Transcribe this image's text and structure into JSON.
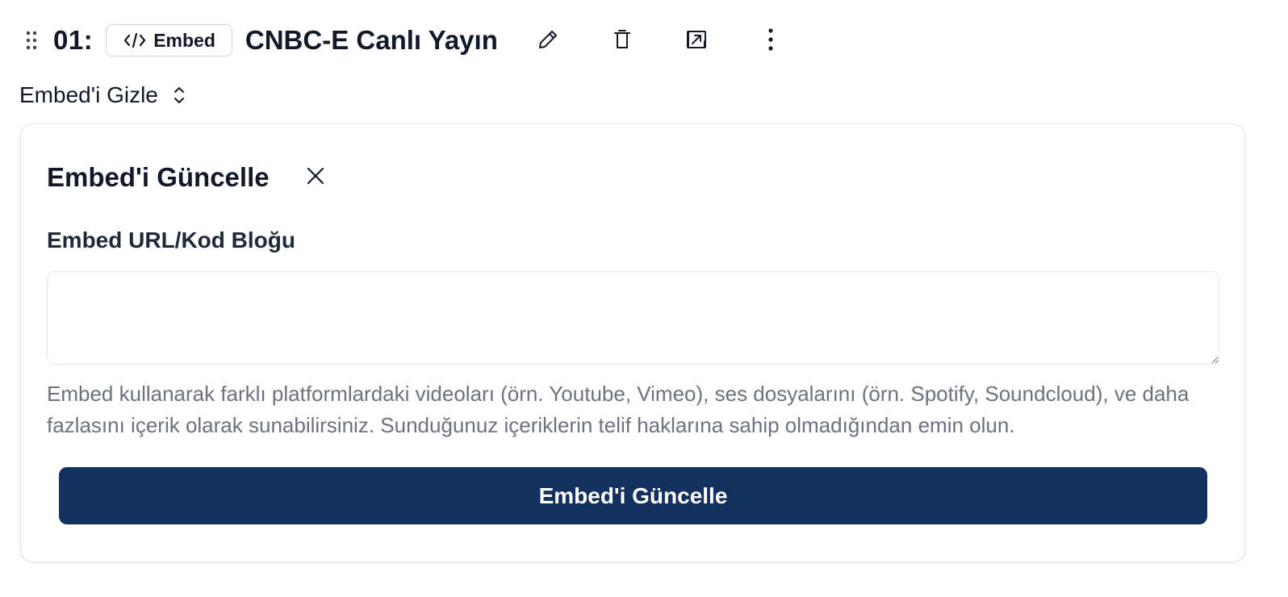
{
  "item": {
    "index_label": "01:",
    "type_badge": {
      "label": "Embed",
      "icon": "code-icon"
    },
    "title": "CNBC-E Canlı Yayın",
    "actions": [
      {
        "name": "edit",
        "icon": "pencil-icon"
      },
      {
        "name": "delete",
        "icon": "trash-icon"
      },
      {
        "name": "open",
        "icon": "external-link-icon"
      },
      {
        "name": "more",
        "icon": "more-vertical-icon"
      }
    ],
    "drag_icon": "drag-handle-icon"
  },
  "toggle": {
    "label": "Embed'i Gizle",
    "icon": "chevrons-up-down-icon"
  },
  "panel": {
    "title": "Embed'i Güncelle",
    "close_icon": "close-icon",
    "field_label": "Embed URL/Kod Bloğu",
    "field_value": "",
    "help_text": "Embed kullanarak farklı platformlardaki videoları (örn. Youtube, Vimeo), ses dosyalarını (örn. Spotify, Soundcloud), ve daha fazlasını içerik olarak sunabilirsiniz. Sunduğunuz içeriklerin telif haklarına sahip olmadığından emin olun.",
    "submit_label": "Embed'i Güncelle"
  },
  "colors": {
    "primary_button": "#14305f",
    "help_text": "#6b7280",
    "border": "#e5e7eb"
  }
}
